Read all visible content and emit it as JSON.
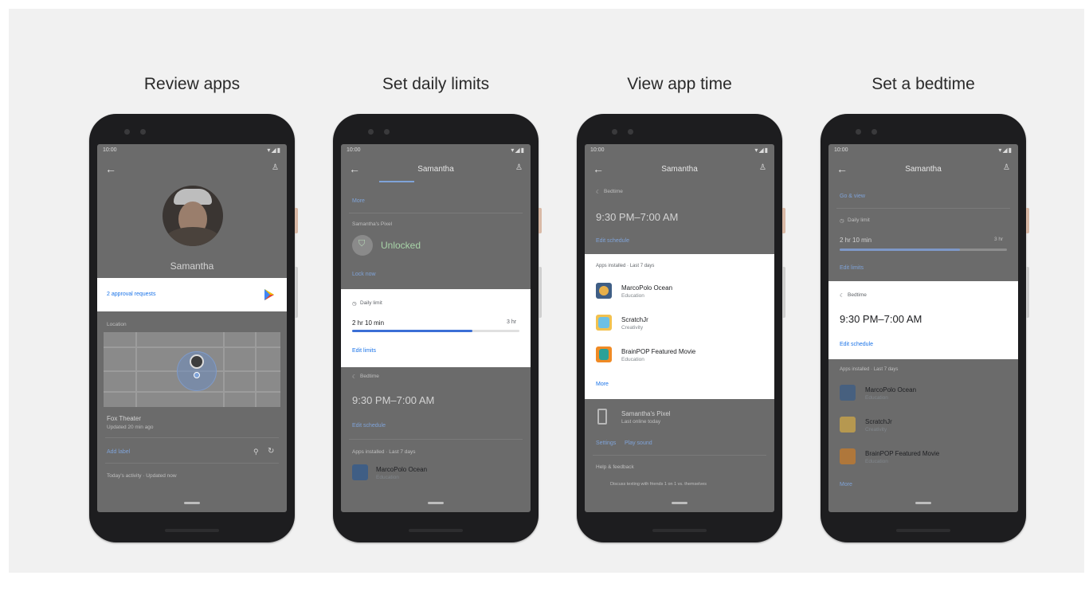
{
  "panels": [
    {
      "heading": "Review apps",
      "status_time": "10:00",
      "profile_name": "Samantha",
      "approval_requests": "2 approval requests",
      "location_label": "Location",
      "place_name": "Fox Theater",
      "place_updated": "Updated 20 min ago",
      "add_label": "Add label",
      "activity_note": "Today's activity · Updated now"
    },
    {
      "heading": "Set daily limits",
      "status_time": "10:00",
      "app_title": "Samantha",
      "more_link": "More",
      "device_label": "Samantha's Pixel",
      "device_state": "Unlocked",
      "lock_now": "Lock now",
      "daily_limit_label": "Daily limit",
      "limit_value": "2 hr 10 min",
      "limit_max": "3 hr",
      "limit_fraction": 0.72,
      "edit_limits": "Edit limits",
      "bedtime_label": "Bedtime",
      "bedtime_value": "9:30 PM–7:00 AM",
      "edit_schedule": "Edit schedule",
      "apps_installed_label": "Apps installed · Last 7 days",
      "app1_name": "MarcoPolo Ocean",
      "app1_cat": "Education"
    },
    {
      "heading": "View app time",
      "status_time": "10:00",
      "app_title": "Samantha",
      "bedtime_label": "Bedtime",
      "bedtime_value": "9:30 PM–7:00 AM",
      "edit_schedule": "Edit schedule",
      "apps_installed_label": "Apps installed · Last 7 days",
      "apps": [
        {
          "name": "MarcoPolo Ocean",
          "cat": "Education"
        },
        {
          "name": "ScratchJr",
          "cat": "Creativity"
        },
        {
          "name": "BrainPOP Featured Movie",
          "cat": "Education"
        }
      ],
      "more_link": "More",
      "device_name": "Samantha's Pixel",
      "device_status": "Last online today",
      "settings_link": "Settings",
      "play_sound_link": "Play sound",
      "tips_label": "Help & feedback",
      "tips_text": "Discuss texting with friends 1 on 1 vs. themselves"
    },
    {
      "heading": "Set a bedtime",
      "status_time": "10:00",
      "app_title": "Samantha",
      "top_link": "Go & view",
      "daily_limit_label": "Daily limit",
      "limit_value": "2 hr 10 min",
      "limit_max": "3 hr",
      "limit_fraction": 0.72,
      "edit_limits": "Edit limits",
      "bedtime_label": "Bedtime",
      "bedtime_value": "9:30 PM–7:00 AM",
      "edit_schedule": "Edit schedule",
      "apps_installed_label": "Apps installed · Last 7 days",
      "apps": [
        {
          "name": "MarcoPolo Ocean",
          "cat": "Education"
        },
        {
          "name": "ScratchJr",
          "cat": "Creativity"
        },
        {
          "name": "BrainPOP Featured Movie",
          "cat": "Education"
        }
      ],
      "more_link": "More"
    }
  ],
  "colors": {
    "stage": "#f1f1f1",
    "phone": "#1d1d1f",
    "dim_screen": "#6b6b6b",
    "card": "#ffffff",
    "link": "#1a73e8",
    "progress": "#3b6fd6"
  },
  "icons": [
    "back-arrow-icon",
    "account-switch-icon",
    "play-store-icon",
    "lock-icon",
    "clock-icon",
    "bedtime-icon",
    "phone-device-icon",
    "person-pin-icon",
    "refresh-icon"
  ]
}
